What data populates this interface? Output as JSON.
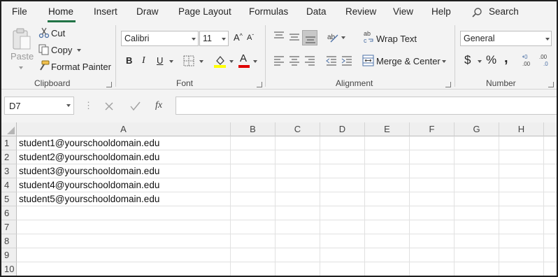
{
  "menu": {
    "tabs": [
      "File",
      "Home",
      "Insert",
      "Draw",
      "Page Layout",
      "Formulas",
      "Data",
      "Review",
      "View",
      "Help"
    ],
    "active_tab": "Home",
    "search_label": "Search"
  },
  "clipboard": {
    "paste_label": "Paste",
    "cut_label": "Cut",
    "copy_label": "Copy",
    "format_painter_label": "Format Painter",
    "group_label": "Clipboard"
  },
  "font": {
    "font_name": "Calibri",
    "font_size": "11",
    "bold_glyph": "B",
    "italic_glyph": "I",
    "underline_glyph": "U",
    "font_color_glyph": "A",
    "group_label": "Font",
    "fill_color": "#ffff00",
    "font_color": "#e00000"
  },
  "alignment": {
    "wrap_text_label": "Wrap Text",
    "merge_center_label": "Merge & Center",
    "group_label": "Alignment"
  },
  "number": {
    "format_value": "General",
    "currency_glyph": "$",
    "percent_glyph": "%",
    "comma_glyph": ",",
    "group_label": "Number"
  },
  "formula_bar": {
    "name_box": "D7",
    "fx_label": "fx",
    "formula": ""
  },
  "sheet": {
    "columns": [
      "A",
      "B",
      "C",
      "D",
      "E",
      "F",
      "G",
      "H"
    ],
    "rows": [
      "1",
      "2",
      "3",
      "4",
      "5",
      "6",
      "7",
      "8",
      "9",
      "10"
    ],
    "cells_a": [
      "student1@yourschooldomain.edu",
      "student2@yourschooldomain.edu",
      "student3@yourschooldomain.edu",
      "student4@yourschooldomain.edu",
      "student5@yourschooldomain.edu",
      "",
      "",
      "",
      "",
      ""
    ]
  },
  "accent_color": "#217346"
}
